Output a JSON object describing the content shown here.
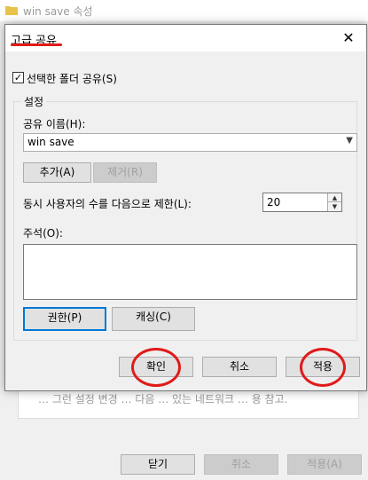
{
  "background_window": {
    "title": "win save 속성",
    "panel_text": "… 그런 설정 변경 … 다음 … 있는 네트워크 … 용 참고.",
    "buttons": {
      "close": "닫기",
      "cancel": "취소",
      "apply": "적용(A)"
    }
  },
  "dialog": {
    "title": "고급 공유",
    "close_glyph": "✕",
    "share_checkbox": {
      "label": "선택한 폴더 공유(S)",
      "checked": true
    },
    "settings_group": {
      "legend": "설정",
      "share_name_label": "공유 이름(H):",
      "share_name_value": "win save",
      "add_button": "추가(A)",
      "remove_button": "제거(R)",
      "limit_label": "동시 사용자의 수를 다음으로 제한(L):",
      "limit_value": "20",
      "comment_label": "주석(O):",
      "comment_value": "",
      "permissions_button": "권한(P)",
      "caching_button": "캐싱(C)"
    },
    "footer": {
      "ok": "확인",
      "cancel": "취소",
      "apply": "적용"
    }
  },
  "annotations": {
    "color": "#e01a1a"
  }
}
